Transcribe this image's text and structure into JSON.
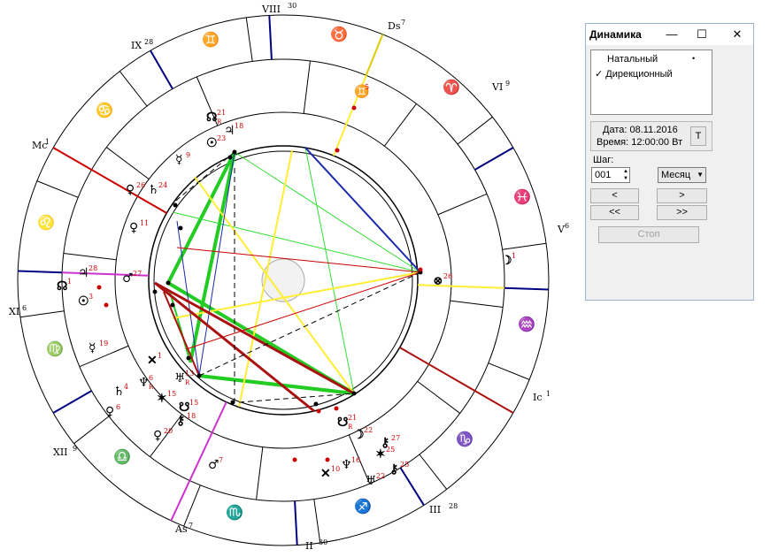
{
  "chart": {
    "houses": [
      {
        "roman": "VIII",
        "deg": "30"
      },
      {
        "roman": "IX",
        "deg": "28"
      },
      {
        "roman": "Mc",
        "deg": "1"
      },
      {
        "roman": "XI",
        "deg": "6"
      },
      {
        "roman": "XII",
        "deg": "9"
      },
      {
        "roman": "As",
        "deg": "7"
      },
      {
        "roman": "II",
        "deg": "30"
      },
      {
        "roman": "III",
        "deg": "28"
      },
      {
        "roman": "Ic",
        "deg": "1"
      },
      {
        "roman": "V",
        "deg": "6"
      },
      {
        "roman": "VI",
        "deg": "9"
      },
      {
        "roman": "Ds",
        "deg": "7"
      }
    ],
    "signs": [
      "♊",
      "♉",
      "♈",
      "♓",
      "♒",
      "♑",
      "♐",
      "♏",
      "♎",
      "♍",
      "♌",
      "♋"
    ],
    "outer_planets": [
      {
        "glyph": "♊",
        "deg": "5",
        "note": "⊗"
      },
      {
        "glyph": "☽",
        "deg": "1"
      },
      {
        "glyph": "⊗",
        "deg": "26"
      },
      {
        "glyph": "☋",
        "deg": "21",
        "r": "R"
      },
      {
        "glyph": "☽",
        "deg": "22"
      },
      {
        "glyph": "⚷",
        "deg": "27"
      },
      {
        "glyph": "✶",
        "deg": "25"
      },
      {
        "glyph": "♆",
        "deg": "16"
      },
      {
        "glyph": "✕",
        "deg": "10"
      },
      {
        "glyph": "♅",
        "deg": "22"
      },
      {
        "glyph": "⚷",
        "deg": "25"
      },
      {
        "glyph": "♂",
        "deg": "7"
      },
      {
        "glyph": "♀",
        "deg": "20"
      },
      {
        "glyph": "⚷",
        "deg": "18"
      },
      {
        "glyph": "☋",
        "deg": "15"
      },
      {
        "glyph": "✶",
        "deg": "15"
      },
      {
        "glyph": "♅",
        "deg": "13",
        "r": "R"
      },
      {
        "glyph": "♆",
        "deg": "6",
        "r": "R"
      },
      {
        "glyph": "♄",
        "deg": "4"
      },
      {
        "glyph": "♀",
        "deg": "6"
      },
      {
        "glyph": "✕",
        "deg": "1"
      },
      {
        "glyph": "☿",
        "deg": "19"
      },
      {
        "glyph": "☉",
        "deg": "3"
      },
      {
        "glyph": "♃",
        "deg": "28"
      },
      {
        "glyph": "☊",
        "deg": "1"
      },
      {
        "glyph": "♂",
        "deg": "27"
      },
      {
        "glyph": "♀",
        "deg": "11"
      },
      {
        "glyph": "♀",
        "deg": "26"
      },
      {
        "glyph": "♄",
        "deg": "24"
      },
      {
        "glyph": "☿",
        "deg": "9"
      },
      {
        "glyph": "☉",
        "deg": "23"
      },
      {
        "glyph": "☊",
        "deg": "21",
        "r": "R"
      },
      {
        "glyph": "♃",
        "deg": "18"
      }
    ]
  },
  "dialog": {
    "title": "Динамика",
    "minimize": "—",
    "maximize": "☐",
    "close": "✕",
    "modes": [
      "Натальный",
      "Дирекционный"
    ],
    "selected_mark": "✓",
    "active_dot": "•",
    "date_label": "Дата:",
    "date_value": "08.11.2016",
    "time_label": "Время:",
    "time_value": "12:00:00 Вт",
    "t_button": "T",
    "step_label": "Шаг:",
    "step_value": "001",
    "unit_value": "Месяц",
    "prev": "<",
    "next": ">",
    "prev_fast": "<<",
    "next_fast": ">>",
    "stop": "Стоп"
  },
  "colors": {
    "green": "#22cc22",
    "yellow": "#ffee33",
    "red": "#cc0000",
    "darkred": "#aa1111",
    "blue": "#1a2aaa",
    "navy": "#000080",
    "magenta": "#cc33cc"
  }
}
